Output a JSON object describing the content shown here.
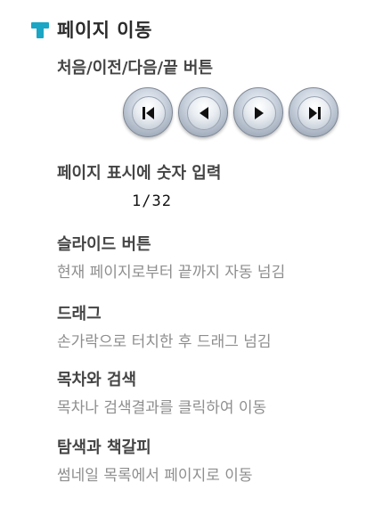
{
  "header": {
    "icon": "pin-icon",
    "accent_color": "#1aa6c4",
    "title": "페이지 이동"
  },
  "nav_buttons": {
    "label": "처음/이전/다음/끝 버튼",
    "buttons": [
      {
        "name": "first-page",
        "icon": "skip-first-icon"
      },
      {
        "name": "prev-page",
        "icon": "play-left-icon"
      },
      {
        "name": "next-page",
        "icon": "play-right-icon"
      },
      {
        "name": "last-page",
        "icon": "skip-last-icon"
      }
    ]
  },
  "page_input": {
    "label": "페이지 표시에 숫자 입력",
    "value": "1/32"
  },
  "sections": [
    {
      "title": "슬라이드 버튼",
      "desc": "현재 페이지로부터 끝까지 자동 넘김"
    },
    {
      "title": "드래그",
      "desc": "손가락으로 터치한 후 드래그 넘김"
    },
    {
      "title": "목차와 검색",
      "desc": "목차나 검색결과를 클릭하여 이동"
    },
    {
      "title": "탐색과 책갈피",
      "desc": "썸네일 목록에서 페이지로 이동"
    }
  ]
}
